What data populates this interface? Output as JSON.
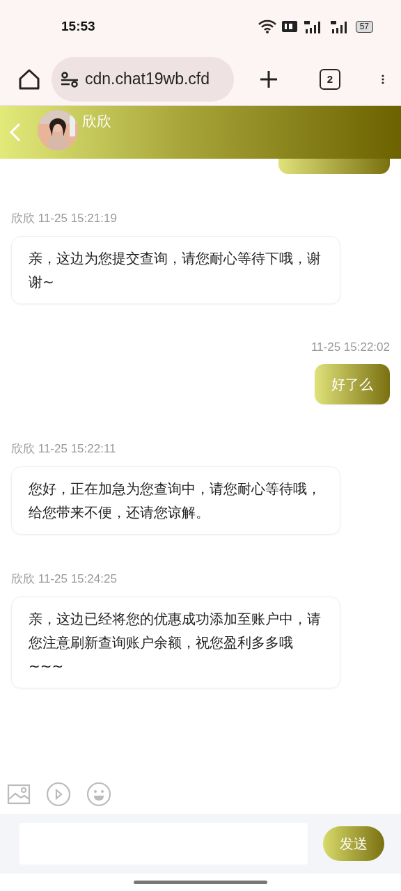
{
  "status_bar": {
    "time": "15:53",
    "battery": "57"
  },
  "browser": {
    "url": "cdn.chat19wb.cfd",
    "tab_count": "2"
  },
  "header": {
    "name": "欣欣"
  },
  "messages": [
    {
      "kind": "received",
      "meta": "欣欣 11-25 15:21:19",
      "text": "亲，这边为您提交查询，请您耐心等待下哦，谢谢~"
    },
    {
      "kind": "sent",
      "meta": "11-25 15:22:02",
      "text": "好了么"
    },
    {
      "kind": "received",
      "meta": "欣欣 11-25 15:22:11",
      "text": "您好，正在加急为您查询中，请您耐心等待哦，给您带来不便，还请您谅解。"
    },
    {
      "kind": "received",
      "meta": "欣欣 11-25 15:24:25",
      "text": "亲，这边已经将您的优惠成功添加至账户中，请您注意刷新查询账户余额，祝您盈利多多哦~~~"
    }
  ],
  "composer": {
    "send": "发送"
  }
}
